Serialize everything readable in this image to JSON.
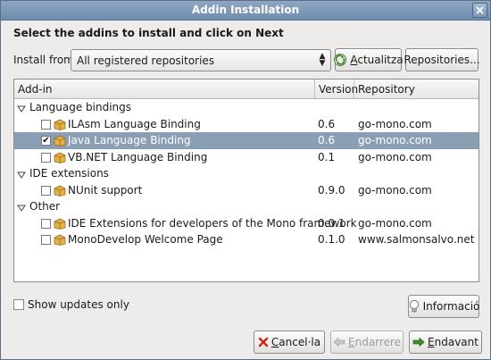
{
  "window": {
    "title": "Addin Installation"
  },
  "instruction": "Select the addins to install and click on Next",
  "install_from": {
    "label": "Install from:",
    "selected": "All registered repositories"
  },
  "buttons": {
    "refresh": {
      "pre": "",
      "accel": "A",
      "post": "ctualitza"
    },
    "repositories": "Repositories...",
    "info": "Informació",
    "cancel": {
      "pre": "",
      "accel": "C",
      "post": "ancel·la"
    },
    "back": {
      "pre": "",
      "accel": "E",
      "post": "ndarrere"
    },
    "next": {
      "pre": "",
      "accel": "E",
      "post": "ndavant"
    }
  },
  "table": {
    "columns": [
      "Add-in",
      "Version",
      "Repository"
    ],
    "groups": [
      {
        "name": "Language bindings",
        "expanded": true,
        "items": [
          {
            "name": "ILAsm Language Binding",
            "version": "0.6",
            "repository": "go-mono.com",
            "checked": false,
            "selected": false
          },
          {
            "name": "Java Language Binding",
            "version": "0.6",
            "repository": "go-mono.com",
            "checked": true,
            "selected": true
          },
          {
            "name": "VB.NET Language Binding",
            "version": "0.1",
            "repository": "go-mono.com",
            "checked": false,
            "selected": false
          }
        ]
      },
      {
        "name": "IDE extensions",
        "expanded": true,
        "items": [
          {
            "name": "NUnit support",
            "version": "0.9.0",
            "repository": "go-mono.com",
            "checked": false,
            "selected": false
          }
        ]
      },
      {
        "name": "Other",
        "expanded": true,
        "items": [
          {
            "name": "IDE Extensions for developers of the Mono framework",
            "version": "0.0.1",
            "repository": "go-mono.com",
            "checked": false,
            "selected": false
          },
          {
            "name": "MonoDevelop Welcome Page",
            "version": "0.1.0",
            "repository": "www.salmonsalvo.net",
            "checked": false,
            "selected": false
          }
        ]
      }
    ]
  },
  "show_updates": {
    "label": "Show updates only",
    "checked": false
  },
  "colors": {
    "selection": "#8b9fb4",
    "titlebar": "#7a95b6",
    "window_bg": "#edeceb",
    "package_icon": "#d9a33a"
  }
}
